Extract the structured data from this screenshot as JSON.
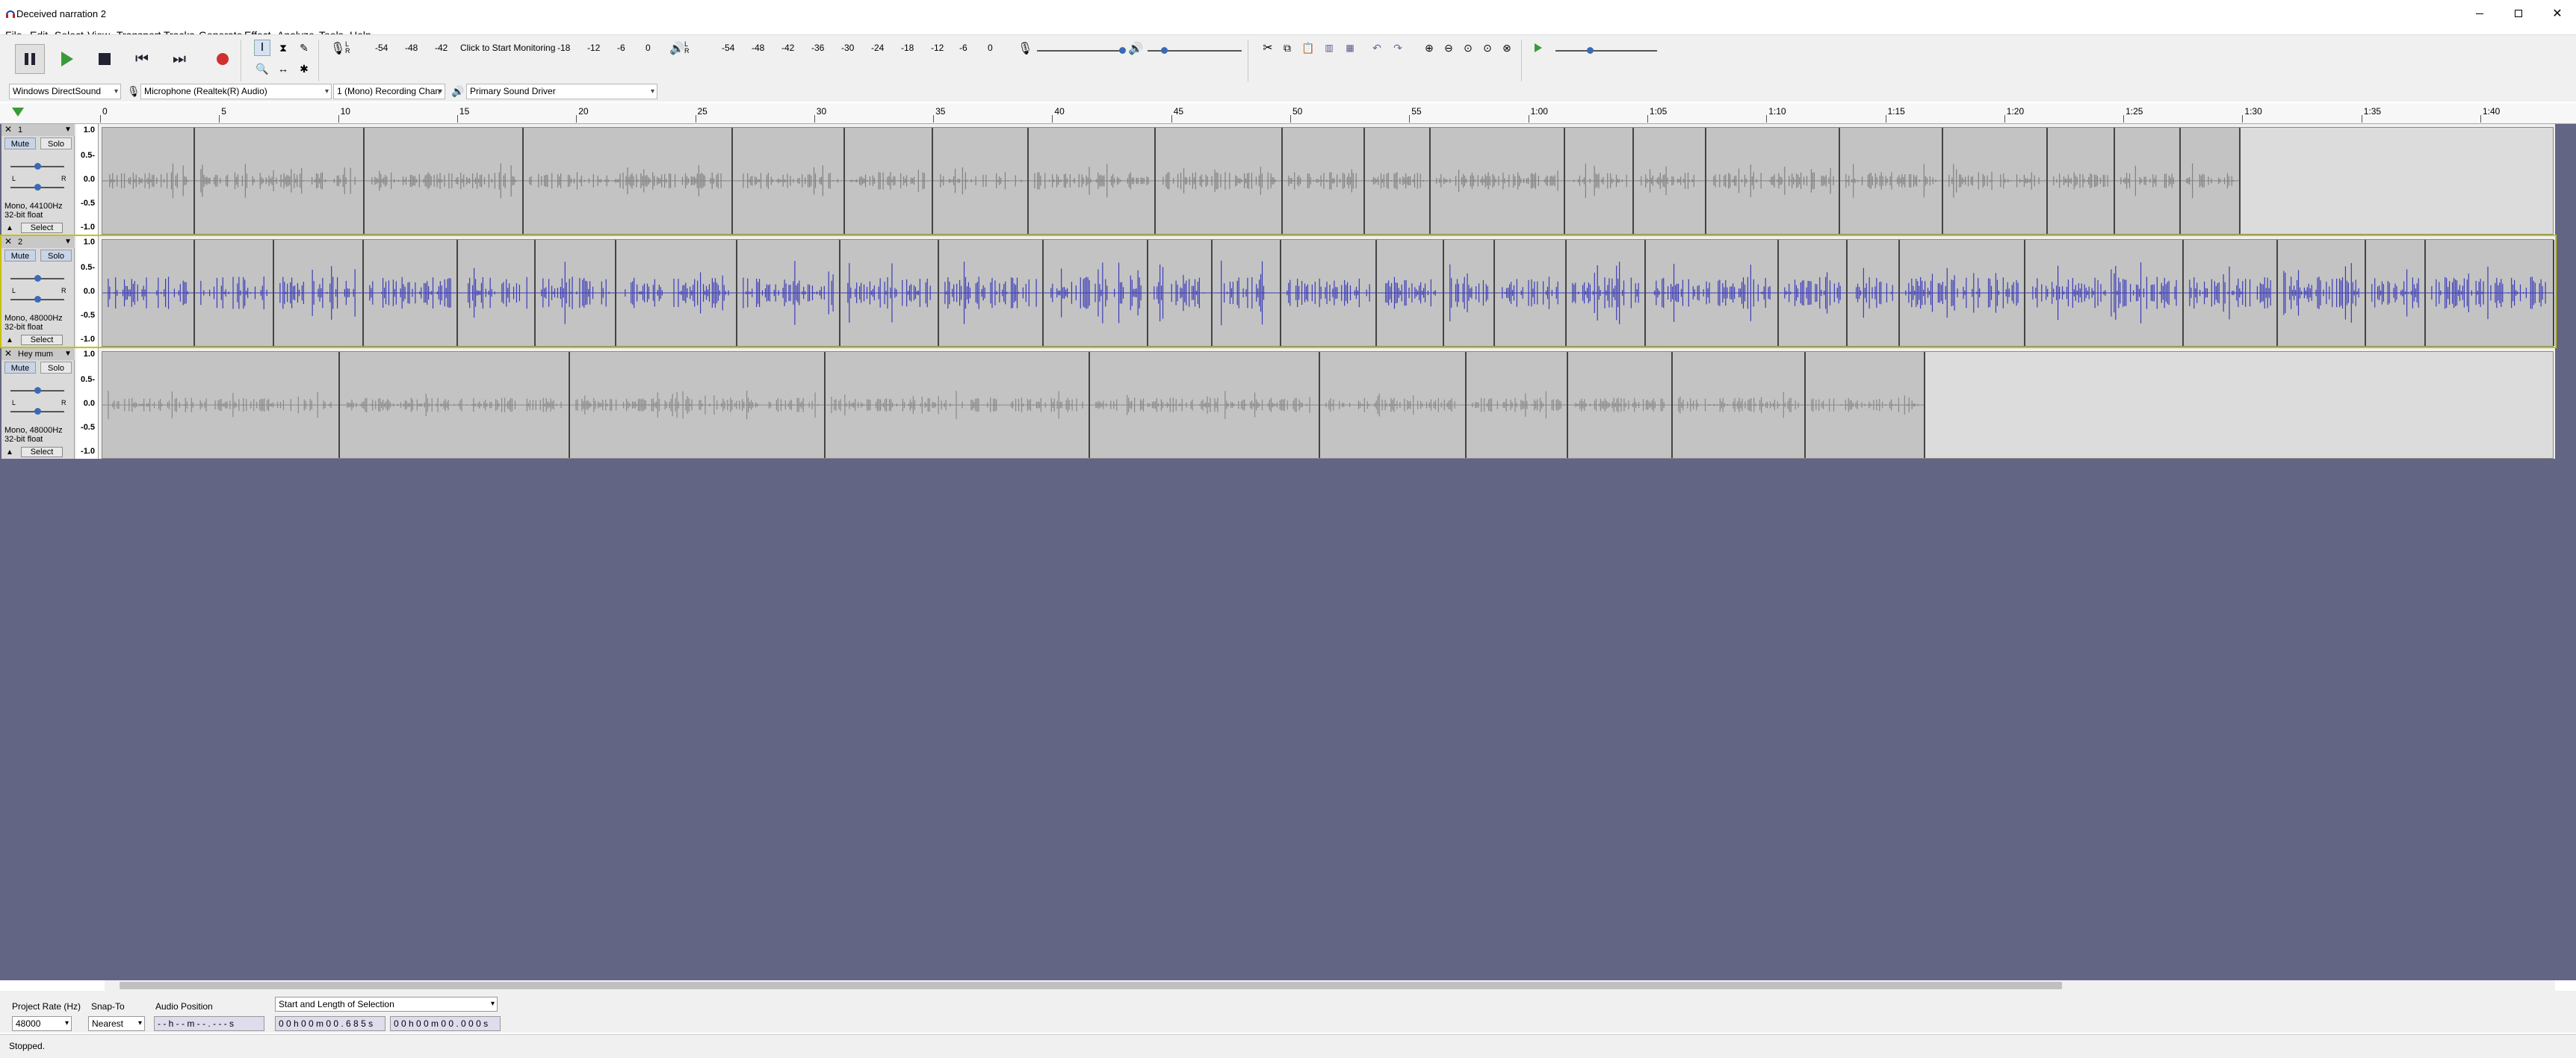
{
  "window": {
    "title": "Deceived narration 2",
    "icon": "audacity-headphones-icon"
  },
  "menu": [
    "File",
    "Edit",
    "Select",
    "View",
    "Transport",
    "Tracks",
    "Generate",
    "Effect",
    "Analyze",
    "Tools",
    "Help"
  ],
  "transport": {
    "pause": "pause-icon",
    "play": "play-icon",
    "stop": "stop-icon",
    "skip_start": "skip-start-icon",
    "skip_end": "skip-end-icon",
    "record": "record-icon"
  },
  "record_meter": {
    "click_to_monitor": "Click to Start Monitoring",
    "scale": [
      "-54",
      "-48",
      "-42",
      "-18",
      "-12",
      "-6",
      "0"
    ]
  },
  "playback_meter": {
    "scale": [
      "-54",
      "-48",
      "-42",
      "-36",
      "-30",
      "-24",
      "-18",
      "-12",
      "-6",
      "0"
    ]
  },
  "devices": {
    "host": "Windows DirectSound",
    "recording_device": "Microphone (Realtek(R) Audio)",
    "recording_channels": "1 (Mono) Recording Chan",
    "playback_device": "Primary Sound Driver"
  },
  "ruler": {
    "ticks": [
      "0",
      "5",
      "10",
      "15",
      "20",
      "25",
      "30",
      "35",
      "40",
      "45",
      "50",
      "55",
      "1:00",
      "1:05",
      "1:10",
      "1:15",
      "1:20",
      "1:25",
      "1:30",
      "1:35",
      "1:40"
    ]
  },
  "tracks": [
    {
      "name": "1",
      "mute": "Mute",
      "solo": "Solo",
      "info1": "Mono, 44100Hz",
      "info2": "32-bit float",
      "select": "Select",
      "y_labels": [
        "1.0",
        "0.5-",
        "0.0",
        "-0.5",
        "-1.0"
      ]
    },
    {
      "name": "2",
      "mute": "Mute",
      "solo": "Solo",
      "info1": "Mono, 48000Hz",
      "info2": "32-bit float",
      "select": "Select",
      "y_labels": [
        "1.0",
        "0.5-",
        "0.0",
        "-0.5",
        "-1.0"
      ]
    },
    {
      "name": "Hey mum",
      "mute": "Mute",
      "solo": "Solo",
      "info1": "Mono, 48000Hz",
      "info2": "32-bit float",
      "select": "Select",
      "y_labels": [
        "1.0",
        "0.5-",
        "0.0",
        "-0.5",
        "-1.0"
      ]
    }
  ],
  "bottom": {
    "project_rate_label": "Project Rate (Hz)",
    "project_rate": "48000",
    "snap_to_label": "Snap-To",
    "snap_to": "Nearest",
    "audio_position_label": "Audio Position",
    "audio_position": "- - h - - m - - . - - - s",
    "selection_mode": "Start and Length of Selection",
    "sel_start": "0 0 h 0 0 m 0 0 . 6 8 5 s",
    "sel_length": "0 0 h 0 0 m 0 0 . 0 0 0 s"
  },
  "status": "Stopped."
}
